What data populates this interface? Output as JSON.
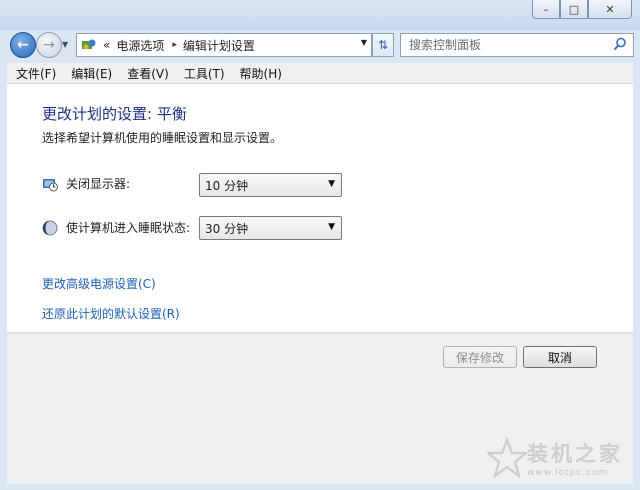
{
  "window": {
    "controls": {
      "minimize": "–",
      "maximize": "□",
      "close": "✕"
    }
  },
  "address": {
    "overflow": "«",
    "crumbs": [
      "电源选项",
      "编辑计划设置"
    ],
    "separator": "▸"
  },
  "search": {
    "placeholder": "搜索控制面板"
  },
  "menubar": {
    "items": [
      "文件(F)",
      "编辑(E)",
      "查看(V)",
      "工具(T)",
      "帮助(H)"
    ]
  },
  "main": {
    "title": "更改计划的设置: 平衡",
    "subtitle": "选择希望计算机使用的睡眠设置和显示设置。",
    "settings": [
      {
        "label": "关闭显示器:",
        "value": "10 分钟",
        "icon": "monitor-clock-icon"
      },
      {
        "label": "使计算机进入睡眠状态:",
        "value": "30 分钟",
        "icon": "moon-icon"
      }
    ],
    "links": {
      "advanced": "更改高级电源设置(C)",
      "restore": "还原此计划的默认设置(R)"
    }
  },
  "buttons": {
    "save": "保存修改",
    "cancel": "取消"
  },
  "watermark": {
    "text": "装机之家",
    "url": "www.lotpc.com"
  },
  "colors": {
    "title": "#1e3287",
    "link": "#1f5fb5",
    "chrome": "#dbe6f3"
  }
}
